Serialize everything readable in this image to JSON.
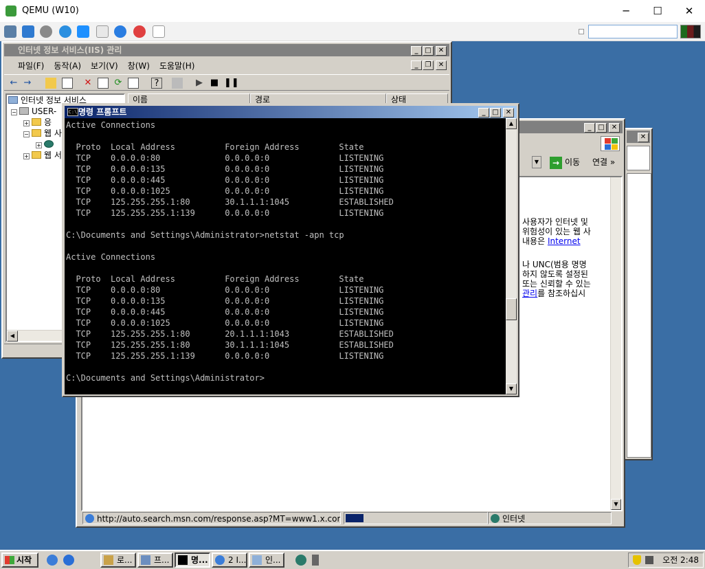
{
  "host": {
    "title": "QEMU (W10)",
    "controls": {
      "minimize": "─",
      "maximize": "☐",
      "close": "✕"
    }
  },
  "iis": {
    "title": "인터넷 정보 서비스(IIS) 관리",
    "menu": [
      "파일(F)",
      "동작(A)",
      "보기(V)",
      "창(W)",
      "도움말(H)"
    ],
    "tree": {
      "root": "인터넷 정보 서비스",
      "computer": "USER-",
      "items": [
        "응",
        "웹 사",
        "",
        "웹 서"
      ]
    },
    "columns": [
      "이름",
      "경로",
      "상태"
    ]
  },
  "ie": {
    "go_label": "이동",
    "links_label": "연결",
    "links_more": "»",
    "body_lines": [
      "사용자가 인터넷 및",
      "위험성이 있는 웹 사",
      "내용은 ",
      "나 UNC(범용 명명",
      "하지 않도록 설정된",
      "또는 신뢰할 수 있는",
      "를 참조하십시"
    ],
    "link_internet": "Internet",
    "link_manage": "관리",
    "status_url": "http://auto.search.msn.com/response.asp?MT=www1.x.com",
    "status_zone": "인터넷"
  },
  "cmd": {
    "title": "명령 프롬프트",
    "icon_text": "C:\\",
    "output": "Active Connections\n\n  Proto  Local Address          Foreign Address        State\n  TCP    0.0.0.0:80             0.0.0.0:0              LISTENING\n  TCP    0.0.0.0:135            0.0.0.0:0              LISTENING\n  TCP    0.0.0.0:445            0.0.0.0:0              LISTENING\n  TCP    0.0.0.0:1025           0.0.0.0:0              LISTENING\n  TCP    125.255.255.1:80       30.1.1.1:1045          ESTABLISHED\n  TCP    125.255.255.1:139      0.0.0.0:0              LISTENING\n\nC:\\Documents and Settings\\Administrator>netstat -apn tcp\n\nActive Connections\n\n  Proto  Local Address          Foreign Address        State\n  TCP    0.0.0.0:80             0.0.0.0:0              LISTENING\n  TCP    0.0.0.0:135            0.0.0.0:0              LISTENING\n  TCP    0.0.0.0:445            0.0.0.0:0              LISTENING\n  TCP    0.0.0.0:1025           0.0.0.0:0              LISTENING\n  TCP    125.255.255.1:80       20.1.1.1:1043          ESTABLISHED\n  TCP    125.255.255.1:80       30.1.1.1:1045          ESTABLISHED\n  TCP    125.255.255.1:139      0.0.0.0:0              LISTENING\n\nC:\\Documents and Settings\\Administrator>"
  },
  "taskbar": {
    "start_label": "시작",
    "tasks": [
      "로...",
      "프...",
      "명...",
      "2 I...",
      "인..."
    ],
    "clock": "오전 2:48"
  },
  "colors": {
    "desktop": "#3a6ea5",
    "active_title": "#0a246a",
    "inactive_title": "#808080",
    "window_face": "#d4d0c8"
  }
}
